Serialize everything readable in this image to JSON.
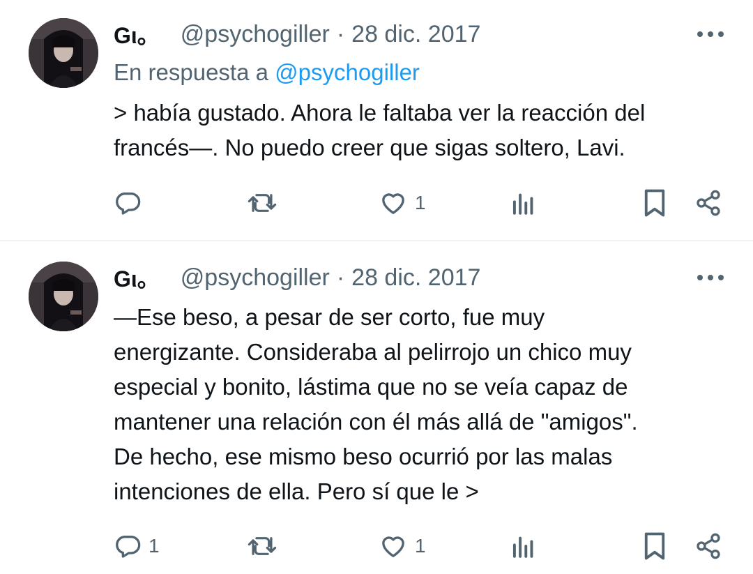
{
  "tweets": [
    {
      "display_name": "Gι。",
      "handle": "@psychogiller",
      "separator": "·",
      "date": "28 dic. 2017",
      "reply_prefix": "En respuesta a",
      "reply_to": "@psychogiller",
      "text_lines": [
        "> había gustado. Ahora le faltaba ver la reacción del",
        "francés—. No puedo creer que sigas soltero, Lavi."
      ],
      "reply_count": "",
      "retweet_count": "",
      "like_count": "1",
      "icons": [
        "more-icon",
        "reply-icon",
        "retweet-icon",
        "like-icon",
        "views-icon",
        "bookmark-icon",
        "share-icon"
      ]
    },
    {
      "display_name": "Gι。",
      "handle": "@psychogiller",
      "separator": "·",
      "date": "28 dic. 2017",
      "text_lines": [
        "—Ese beso, a pesar de ser corto, fue muy",
        "energizante. Consideraba al pelirrojo un chico muy",
        "especial y bonito, lástima que no se veía capaz de",
        "mantener una relación con él más allá de \"amigos\".",
        "De hecho, ese mismo beso ocurrió por las malas",
        "intenciones de ella. Pero sí que le >"
      ],
      "reply_count": "1",
      "retweet_count": "",
      "like_count": "1",
      "icons": [
        "more-icon",
        "reply-icon",
        "retweet-icon",
        "like-icon",
        "views-icon",
        "bookmark-icon",
        "share-icon"
      ]
    }
  ],
  "colors": {
    "text": "#0f1419",
    "secondary": "#536471",
    "link": "#1d9bf0",
    "divider": "#eff3f4"
  }
}
